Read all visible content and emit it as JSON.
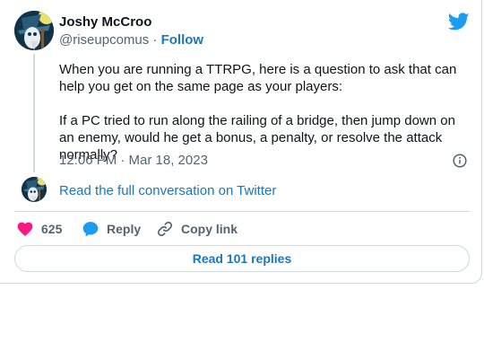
{
  "author": {
    "display_name": "Joshy McCroo",
    "handle": "@riseupcomus",
    "separator": " · ",
    "follow_label": "Follow",
    "avatar_icon": "wizard-avatar-icon"
  },
  "tweet": {
    "text": "When you are running a TTRPG, here is a question to ask that can help you get on the same page as your players:\n\nIf a PC tried to run along the railing of a bridge, then jump down on an enemy, would he get a bonus, a penalty, or resolve the attack normally?",
    "timestamp": "12:06 PM · Mar 18, 2023"
  },
  "conversation": {
    "read_full_label": "Read the full conversation on Twitter"
  },
  "actions": {
    "like_count": "625",
    "reply_label": "Reply",
    "copy_link_label": "Copy link"
  },
  "replies": {
    "read_replies_label": "Read 101 replies"
  },
  "colors": {
    "brand_blue": "#1d9bf0",
    "link_blue": "#1d76bd",
    "like_red": "#f91880",
    "muted_text": "#536471",
    "border": "#cfd9de"
  }
}
